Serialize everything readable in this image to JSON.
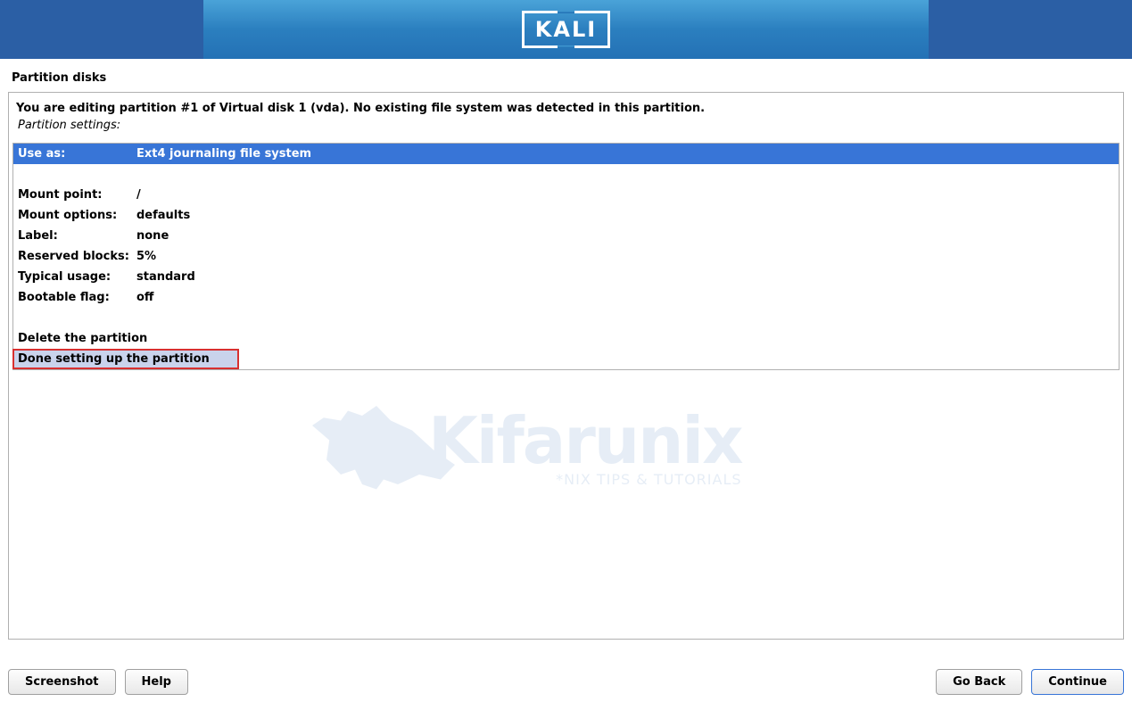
{
  "header": {
    "logo_text": "KALI"
  },
  "page": {
    "title": "Partition disks",
    "info_text": "You are editing partition #1 of Virtual disk 1 (vda). No existing file system was detected in this partition.",
    "sub_text": "Partition settings:"
  },
  "settings": {
    "use_as": {
      "label": "Use as:",
      "value": "Ext4 journaling file system"
    },
    "mount_point": {
      "label": "Mount point:",
      "value": "/"
    },
    "mount_options": {
      "label": "Mount options:",
      "value": "defaults"
    },
    "labelf": {
      "label": "Label:",
      "value": "none"
    },
    "reserved_blocks": {
      "label": "Reserved blocks:",
      "value": "5%"
    },
    "typical_usage": {
      "label": "Typical usage:",
      "value": "standard"
    },
    "bootable_flag": {
      "label": "Bootable flag:",
      "value": "off"
    }
  },
  "actions": {
    "delete": "Delete the partition",
    "done": "Done setting up the partition"
  },
  "watermark": {
    "main": "Kifarunix",
    "sub": "*NIX TIPS & TUTORIALS"
  },
  "footer": {
    "screenshot": "Screenshot",
    "help": "Help",
    "go_back": "Go Back",
    "continue": "Continue"
  }
}
